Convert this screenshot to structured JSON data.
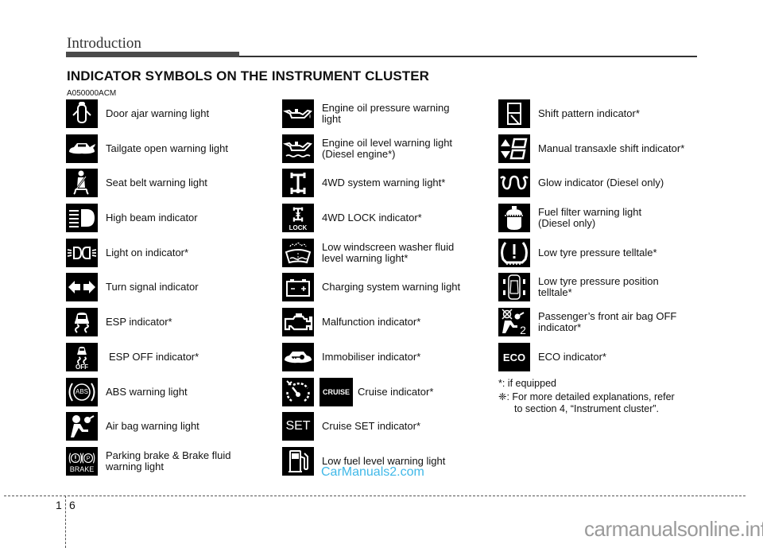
{
  "header": {
    "section": "Introduction"
  },
  "title": "INDICATOR SYMBOLS ON THE INSTRUMENT CLUSTER",
  "code": "A050000ACM",
  "columns": [
    {
      "items": [
        {
          "icon": "door-ajar-icon",
          "label": "Door ajar warning light"
        },
        {
          "icon": "tailgate-open-icon",
          "label": "Tailgate open warning light"
        },
        {
          "icon": "seat-belt-icon",
          "label": "Seat belt warning light"
        },
        {
          "icon": "high-beam-icon",
          "label": "High beam indicator"
        },
        {
          "icon": "light-on-icon",
          "label": "Light on indicator*"
        },
        {
          "icon": "turn-signal-icon",
          "label": "Turn signal indicator"
        },
        {
          "icon": "esp-icon",
          "label": "ESP indicator*"
        },
        {
          "icon": "esp-off-icon",
          "label": "ESP OFF indicator*",
          "icon_text": "OFF"
        },
        {
          "icon": "abs-icon",
          "label": "ABS warning light",
          "icon_text": "ABS"
        },
        {
          "icon": "air-bag-icon",
          "label": "Air bag warning light"
        },
        {
          "icon": "brake-icon",
          "label": "Parking brake & Brake fluid\nwarning light",
          "icon_text": "BRAKE"
        }
      ]
    },
    {
      "items": [
        {
          "icon": "oil-pressure-icon",
          "label": "Engine oil pressure warning\nlight"
        },
        {
          "icon": "oil-level-icon",
          "label": "Engine oil level warning light\n(Diesel engine*)"
        },
        {
          "icon": "4wd-system-icon",
          "label": "4WD system warning light*"
        },
        {
          "icon": "4wd-lock-icon",
          "label": "4WD LOCK indicator*",
          "icon_text": "LOCK"
        },
        {
          "icon": "washer-fluid-icon",
          "label": "Low windscreen washer fluid\nlevel warning light*"
        },
        {
          "icon": "battery-icon",
          "label": "Charging system warning light"
        },
        {
          "icon": "engine-malfunction-icon",
          "label": "Malfunction indicator*"
        },
        {
          "icon": "immobiliser-icon",
          "label": "Immobiliser indicator*"
        },
        {
          "icon": "cruise-icon",
          "label": "Cruise indicator*",
          "icon_text": "CRUISE"
        },
        {
          "icon": "cruise-set-icon",
          "label": "Cruise SET indicator*",
          "icon_text": "SET"
        },
        {
          "icon": "low-fuel-icon",
          "label": "Low fuel level warning light"
        }
      ]
    },
    {
      "items": [
        {
          "icon": "shift-pattern-icon",
          "label": "Shift pattern indicator*"
        },
        {
          "icon": "manual-shift-icon",
          "label": "Manual transaxle shift indicator*"
        },
        {
          "icon": "glow-plug-icon",
          "label": "Glow indicator (Diesel only)"
        },
        {
          "icon": "fuel-filter-icon",
          "label": "Fuel filter warning light\n(Diesel only)"
        },
        {
          "icon": "tyre-pressure-icon",
          "label": "Low tyre pressure telltale*"
        },
        {
          "icon": "tyre-position-icon",
          "label": "Low tyre pressure position\ntelltale*"
        },
        {
          "icon": "passenger-airbag-off-icon",
          "label": "Passenger’s front air bag OFF\nindicator*"
        },
        {
          "icon": "eco-icon",
          "label": "ECO indicator*",
          "icon_text": "ECO"
        }
      ]
    }
  ],
  "notes": {
    "equipped": "*: if equipped",
    "refer_line1": "❈: For more detailed explanations, refer",
    "refer_line2": "to section 4, “Instrument cluster”."
  },
  "watermark_top": "CarManuals2.com",
  "footer": {
    "section_no": "1",
    "page_no": "6",
    "watermark": "carmanualsonline.info"
  }
}
